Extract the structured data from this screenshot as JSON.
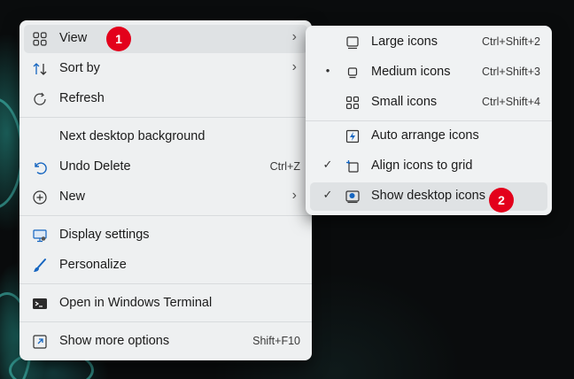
{
  "main_menu": {
    "items": [
      {
        "label": "View",
        "icon": "view-grid-icon",
        "submenu": true
      },
      {
        "label": "Sort by",
        "icon": "sort-icon",
        "submenu": true
      },
      {
        "label": "Refresh",
        "icon": "refresh-icon"
      },
      {
        "label": "Next desktop background"
      },
      {
        "label": "Undo Delete",
        "icon": "undo-icon",
        "shortcut": "Ctrl+Z"
      },
      {
        "label": "New",
        "icon": "new-plus-icon",
        "submenu": true
      },
      {
        "label": "Display settings",
        "icon": "display-icon"
      },
      {
        "label": "Personalize",
        "icon": "brush-icon"
      },
      {
        "label": "Open in Windows Terminal",
        "icon": "terminal-icon"
      },
      {
        "label": "Show more options",
        "icon": "show-more-icon",
        "shortcut": "Shift+F10"
      }
    ]
  },
  "view_submenu": {
    "items": [
      {
        "label": "Large icons",
        "shortcut": "Ctrl+Shift+2",
        "icon": "large-icons-icon",
        "mark": ""
      },
      {
        "label": "Medium icons",
        "shortcut": "Ctrl+Shift+3",
        "icon": "medium-icons-icon",
        "mark": "•"
      },
      {
        "label": "Small icons",
        "shortcut": "Ctrl+Shift+4",
        "icon": "small-icons-icon",
        "mark": ""
      },
      {
        "label": "Auto arrange icons",
        "icon": "auto-arrange-icon",
        "mark": ""
      },
      {
        "label": "Align icons to grid",
        "icon": "align-grid-icon",
        "mark": "✓"
      },
      {
        "label": "Show desktop icons",
        "icon": "show-desktop-icons-icon",
        "mark": "✓"
      }
    ]
  },
  "badges": [
    "1",
    "2"
  ],
  "colors": {
    "accent": "#1565c0",
    "badge": "#e3001b",
    "menu_bg": "#eef0f1"
  }
}
